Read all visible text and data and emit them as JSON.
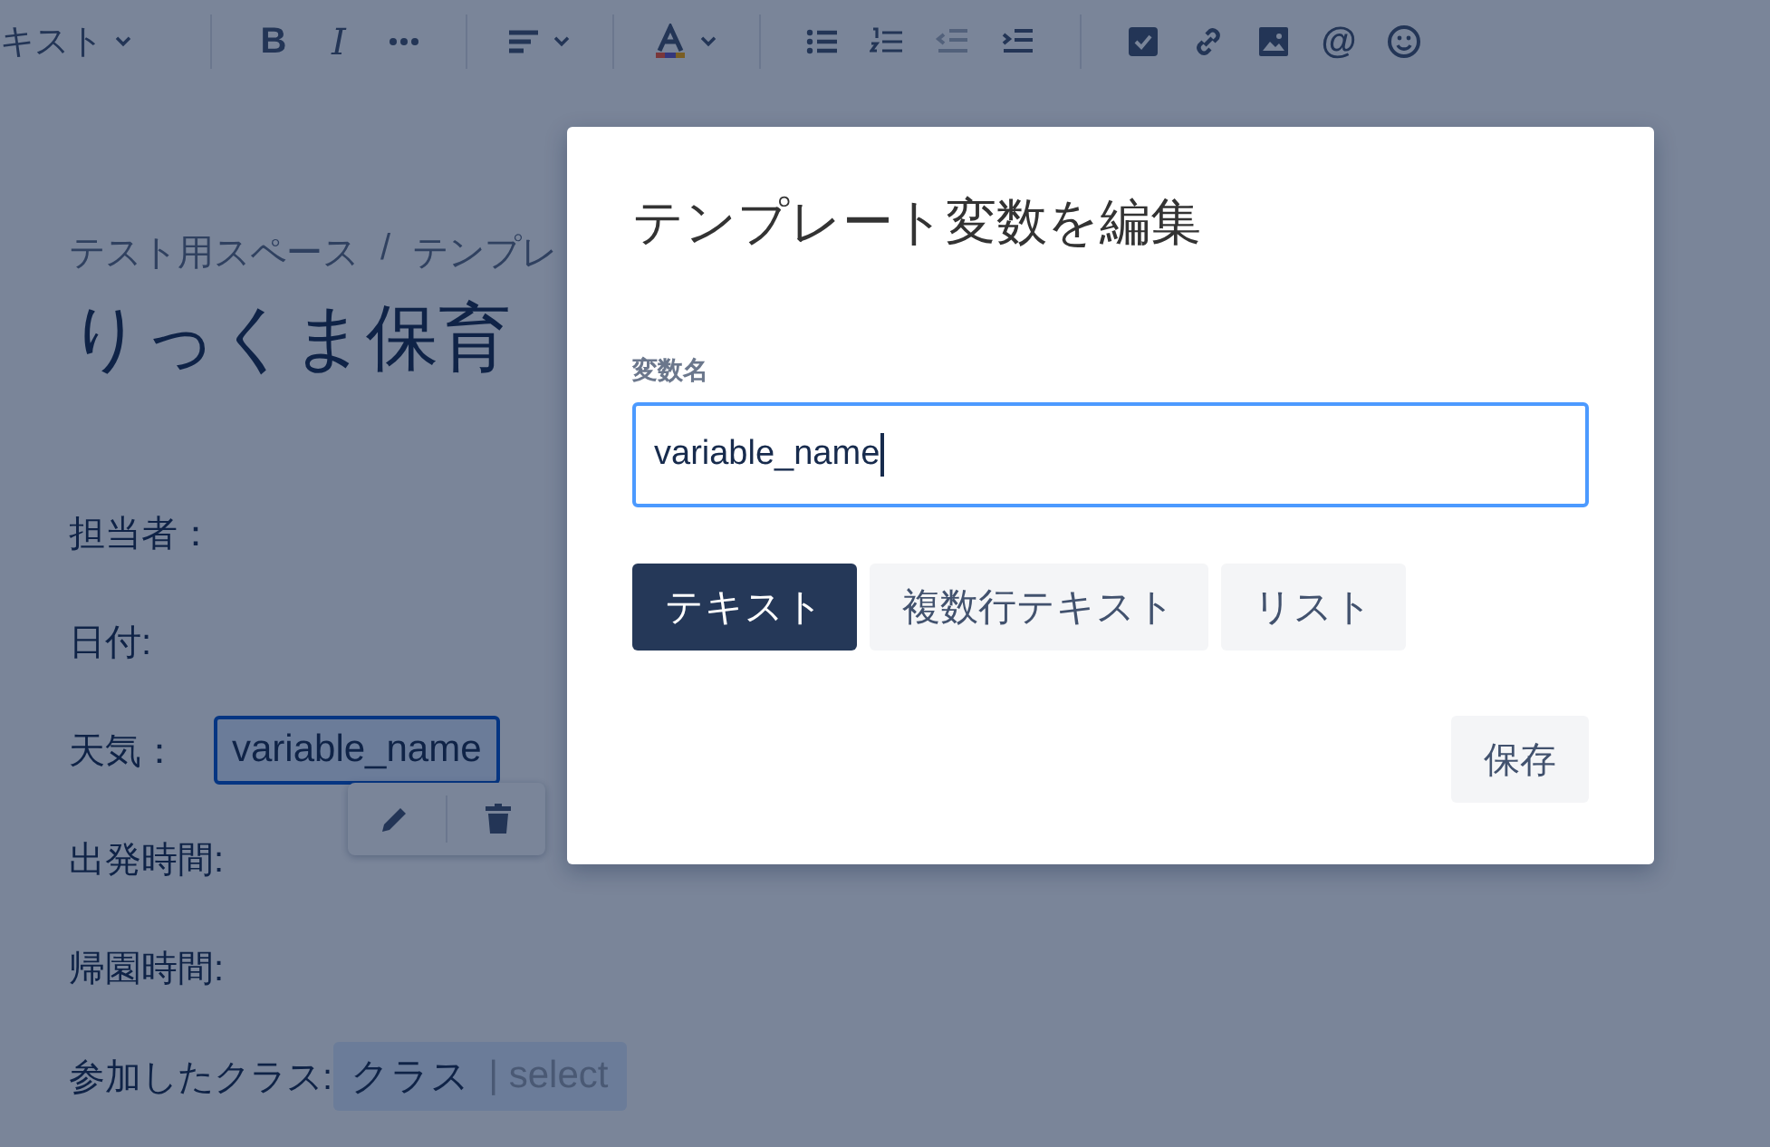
{
  "toolbar": [
    {
      "kind": "style",
      "label": "キスト",
      "disabled": false
    },
    {
      "kind": "divider"
    },
    {
      "kind": "bold",
      "label": "B",
      "disabled": false
    },
    {
      "kind": "italic",
      "label": "I",
      "disabled": false
    },
    {
      "kind": "more",
      "disabled": false
    },
    {
      "kind": "divider"
    },
    {
      "kind": "align",
      "disabled": false
    },
    {
      "kind": "divider"
    },
    {
      "kind": "color",
      "disabled": false
    },
    {
      "kind": "divider"
    },
    {
      "kind": "bullets",
      "disabled": false
    },
    {
      "kind": "numbers",
      "disabled": false
    },
    {
      "kind": "outdent",
      "disabled": true
    },
    {
      "kind": "indent",
      "disabled": false
    },
    {
      "kind": "divider"
    },
    {
      "kind": "task",
      "disabled": false
    },
    {
      "kind": "link",
      "disabled": false
    },
    {
      "kind": "image",
      "disabled": false
    },
    {
      "kind": "mention",
      "label": "@",
      "disabled": false
    },
    {
      "kind": "emoji",
      "disabled": false
    }
  ],
  "breadcrumb": {
    "items": [
      "テスト用スペース",
      "テンプレ"
    ],
    "separator": "/"
  },
  "page_title": "りっくま保育",
  "fields": [
    {
      "label": "担当者：",
      "kind": "plain"
    },
    {
      "label": "日付:",
      "kind": "plain"
    },
    {
      "label": "天気：",
      "kind": "variable",
      "value": "variable_name",
      "selected": true
    },
    {
      "label": "出発時間:",
      "kind": "plain"
    },
    {
      "label": "帰園時間:",
      "kind": "plain"
    },
    {
      "label": "参加したクラス:",
      "kind": "select",
      "value": "クラス",
      "hint": "| select",
      "selected": false
    }
  ],
  "dialog": {
    "title": "テンプレート変数を編集",
    "field_label": "変数名",
    "value": "variable_name",
    "types": [
      {
        "label": "テキスト",
        "selected": true
      },
      {
        "label": "複数行テキスト",
        "selected": false
      },
      {
        "label": "リスト",
        "selected": false
      }
    ],
    "save": "保存"
  }
}
